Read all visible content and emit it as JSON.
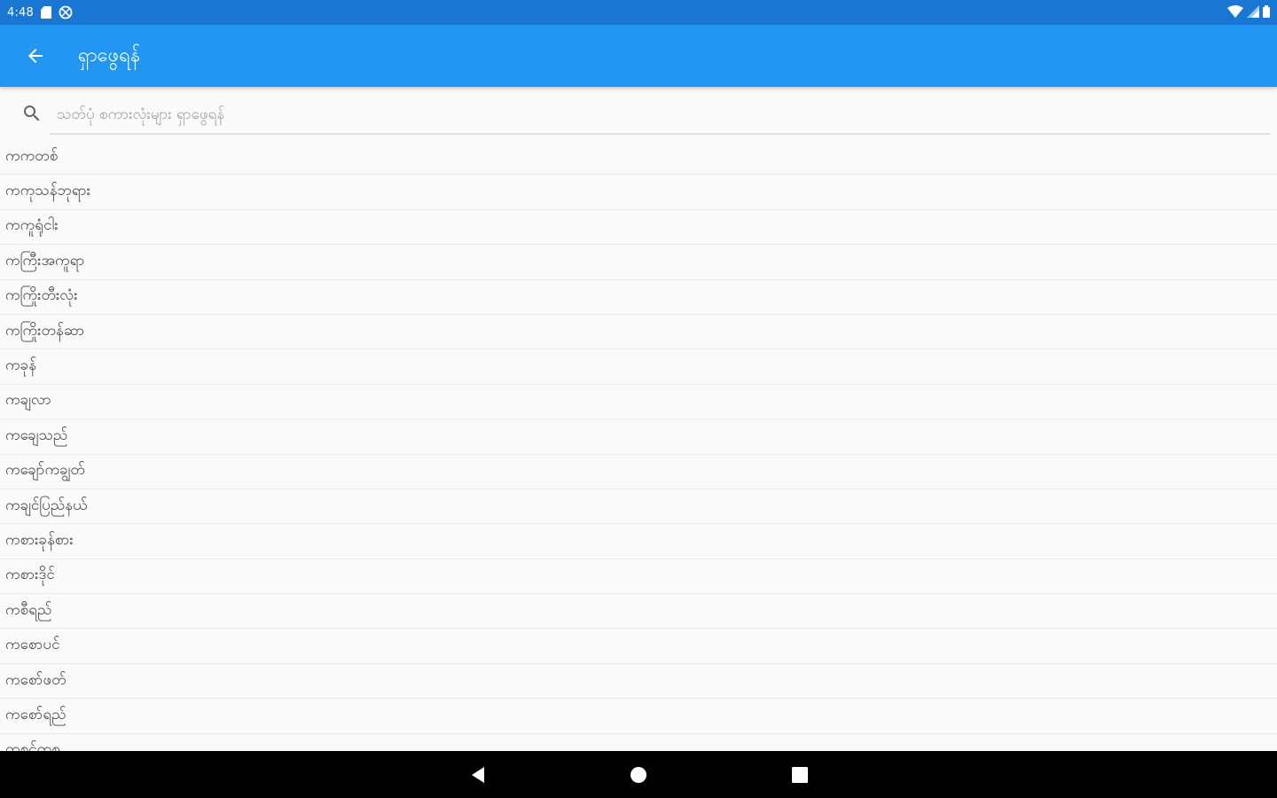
{
  "status_bar": {
    "time": "4:48",
    "left_icons": [
      "sd-card-icon",
      "sync-disabled-icon"
    ],
    "right_icons": [
      "wifi-icon",
      "cell-signal-icon",
      "battery-icon"
    ]
  },
  "app_bar": {
    "title": "ရှာဖွေရန်",
    "back_icon": "arrow-back-icon",
    "color": "#2196f3",
    "status_color": "#1976d2"
  },
  "search": {
    "placeholder": "သတ်ပုံ စကားလုံးများ ရှာဖွေရန်",
    "value": ""
  },
  "words": [
    "ကကတစ်",
    "ကကုသန်ဘုရား",
    "ကကူရုံငါး",
    "ကကြီးအကူရာ",
    "ကကြိုးတီးလုံး",
    "ကကြိုးတန်ဆာ",
    "ကခုန်",
    "ကချလာ",
    "ကချေသည်",
    "ကချော်ကချွတ်",
    "ကချင်ပြည်နယ်",
    "ကစားခုန်စား",
    "ကစားဒိုင်",
    "ကစီရည်",
    "ကစောပင်",
    "ကစော်ဖတ်",
    "ကစော်ရည်",
    "ကစင်ကစ"
  ],
  "nav_bar": {
    "buttons": [
      "back-triangle-icon",
      "home-circle-icon",
      "recents-square-icon"
    ]
  }
}
